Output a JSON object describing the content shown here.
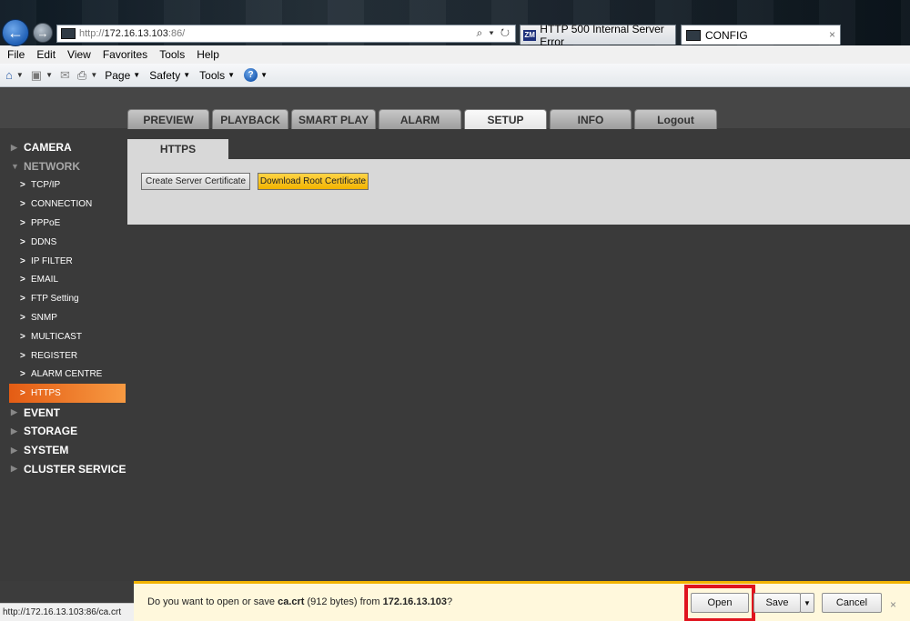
{
  "browser": {
    "address": {
      "url_prefix": "http://",
      "url_host": "172.16.13.103",
      "url_port": ":86/",
      "tools": "⌕ ▾ ↻"
    },
    "tabs": [
      {
        "favicon": "ZM",
        "title": "HTTP 500 Internal Server Error"
      },
      {
        "title": "CONFIG",
        "close": "×"
      }
    ],
    "menu": [
      "File",
      "Edit",
      "View",
      "Favorites",
      "Tools",
      "Help"
    ],
    "commands": {
      "page": "Page",
      "safety": "Safety",
      "tools": "Tools",
      "help": "?"
    }
  },
  "app": {
    "nav_tabs": [
      {
        "label": "PREVIEW"
      },
      {
        "label": "PLAYBACK"
      },
      {
        "label": "SMART PLAY"
      },
      {
        "label": "ALARM"
      },
      {
        "label": "SETUP",
        "active": true
      },
      {
        "label": "INFO"
      },
      {
        "label": "Logout"
      }
    ],
    "sidebar": {
      "camera": "CAMERA",
      "network": "NETWORK",
      "network_items": [
        "TCP/IP",
        "CONNECTION",
        "PPPoE",
        "DDNS",
        "IP FILTER",
        "EMAIL",
        "FTP Setting",
        "SNMP",
        "MULTICAST",
        "REGISTER",
        "ALARM CENTRE",
        "HTTPS"
      ],
      "event": "EVENT",
      "storage": "STORAGE",
      "system": "SYSTEM",
      "cluster": "CLUSTER SERVICE"
    },
    "content": {
      "tab_title": "HTTPS",
      "create_btn": "Create Server Certificate",
      "download_btn": "Download Root Certificate"
    }
  },
  "statusbar": {
    "url": "http://172.16.13.103:86/ca.crt"
  },
  "notification": {
    "prefix": "Do you want to open or save ",
    "filename": "ca.crt",
    "size": " (912 bytes) from ",
    "host": "172.16.13.103",
    "suffix": "?",
    "open": "Open",
    "save": "Save",
    "cancel": "Cancel",
    "close": "×"
  },
  "colors": {
    "accent_orange": "#f28c28",
    "download_yellow": "#f5c400",
    "highlight_red": "#e0141e"
  }
}
